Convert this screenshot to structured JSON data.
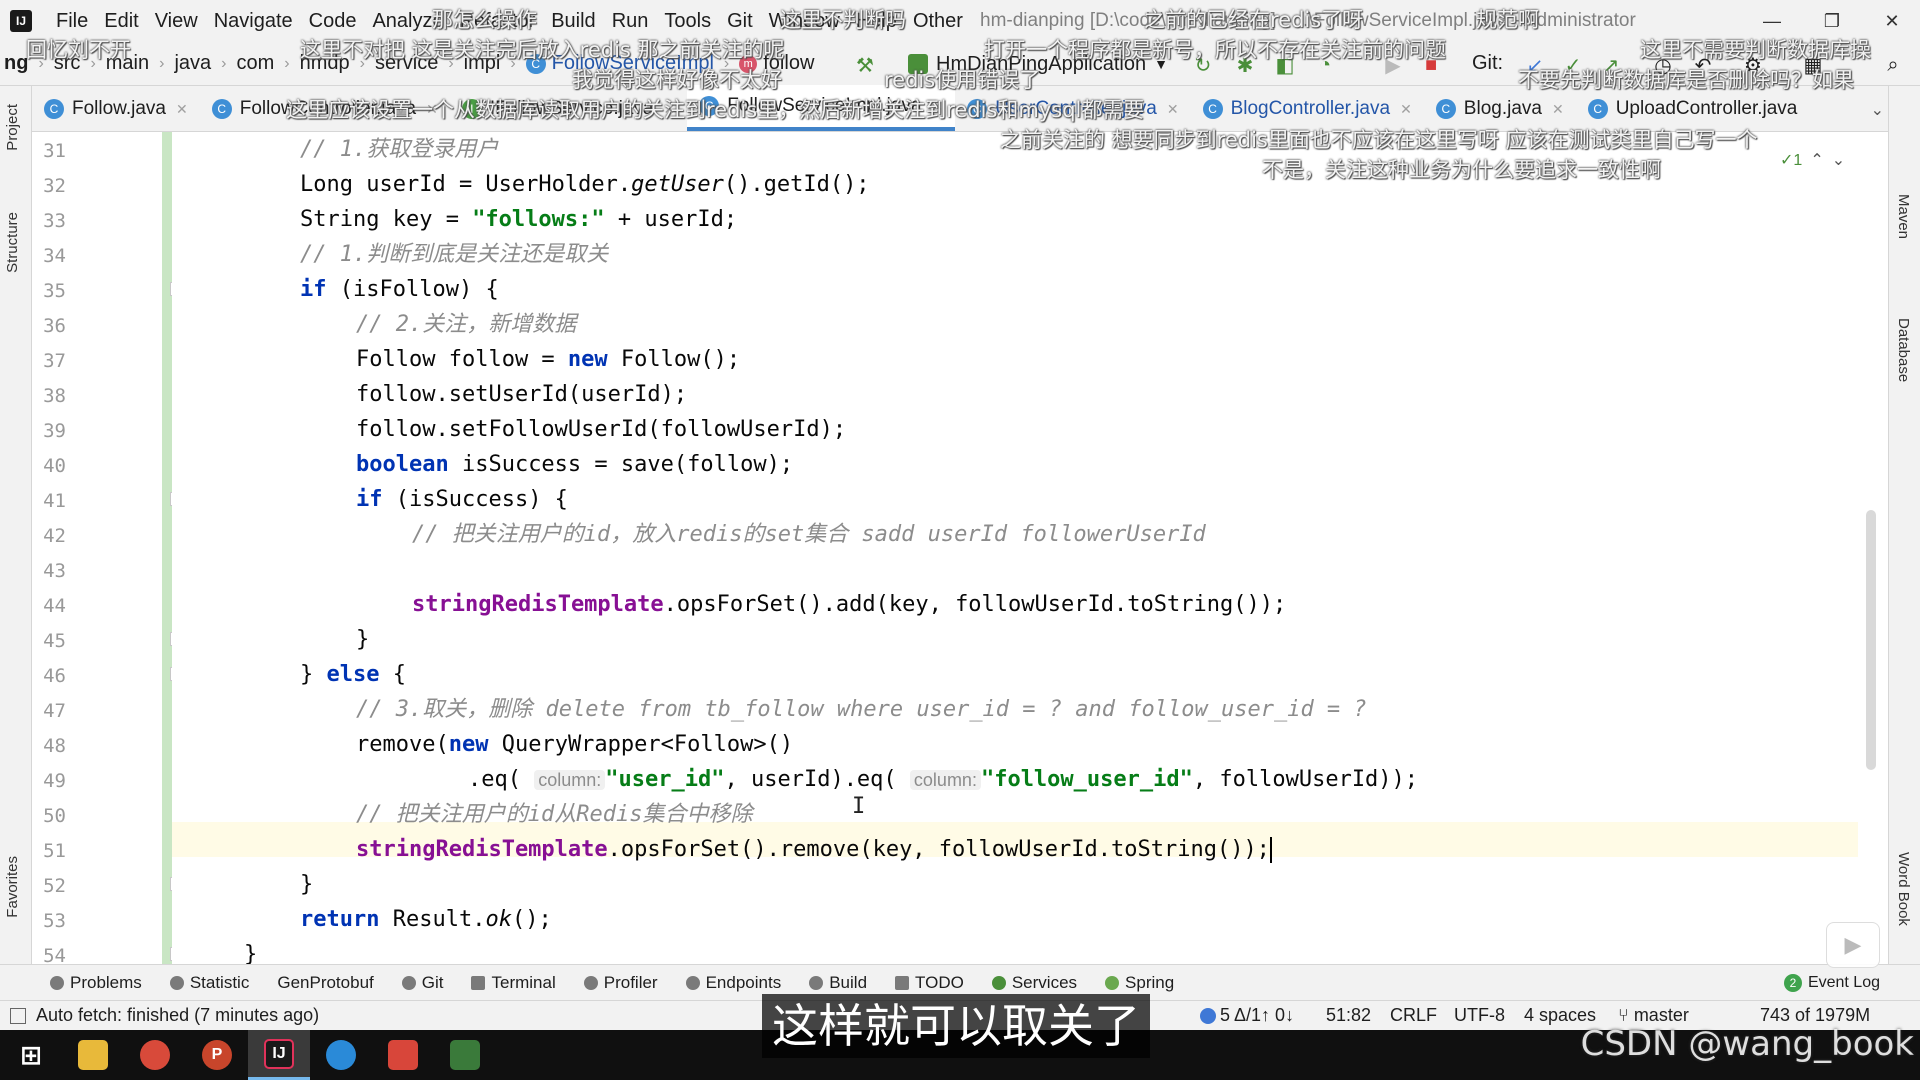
{
  "app": {
    "logo_text": "IJ",
    "window_title": "hm-dianping [D:\\code\\hm-dianping] - ...\\FollowServiceImpl.java - Administrator"
  },
  "menu": [
    "File",
    "Edit",
    "View",
    "Navigate",
    "Code",
    "Analyze",
    "Refactor",
    "Build",
    "Run",
    "Tools",
    "Git",
    "Window",
    "Help",
    "Other"
  ],
  "window_controls": {
    "minimize": "—",
    "restore": "❐",
    "close": "✕"
  },
  "breadcrumb": [
    "ng",
    "src",
    "main",
    "java",
    "com",
    "hmdp",
    "service",
    "impl",
    "FollowServiceImpl",
    "follow"
  ],
  "run_config": {
    "name": "HmDianPingApplication",
    "git_label": "Git:"
  },
  "tabs": [
    {
      "label": "Follow.java",
      "active": false
    },
    {
      "label": "FollowController.java",
      "active": false
    },
    {
      "label": "IFollowService.java",
      "active": false
    },
    {
      "label": "FollowServiceImpl.java",
      "active": true
    },
    {
      "label": "UserController.java",
      "active": false
    },
    {
      "label": "BlogController.java",
      "active": false
    },
    {
      "label": "Blog.java",
      "active": false
    },
    {
      "label": "UploadController.java",
      "active": false
    }
  ],
  "left_tool_windows": [
    "Project",
    "Structure",
    "Favorites"
  ],
  "right_tool_windows": [
    "Maven",
    "Database",
    "Word Book"
  ],
  "inspection": {
    "checks": "✓1",
    "up": "⌃",
    "down": "⌄"
  },
  "editor": {
    "line_numbers": [
      "31",
      "32",
      "33",
      "34",
      "35",
      "36",
      "37",
      "38",
      "39",
      "40",
      "41",
      "42",
      "43",
      "44",
      "45",
      "46",
      "47",
      "48",
      "49",
      "50",
      "51",
      "52",
      "53",
      "54"
    ],
    "current_line": "51",
    "hint_column": "column:",
    "lines": {
      "l31": "// 1.获取登录用户",
      "l32a": "Long userId = UserHolder.",
      "l32b": "getUser",
      "l32c": "().getId();",
      "l33a": "String key = ",
      "l33b": "\"follows:\"",
      "l33c": " + userId;",
      "l34": "// 1.判断到底是关注还是取关",
      "l35a": "if",
      "l35b": " (isFollow) {",
      "l36": "// 2.关注，新增数据",
      "l37a": "Follow follow = ",
      "l37b": "new",
      "l37c": " Follow();",
      "l38": "follow.setUserId(userId);",
      "l39": "follow.setFollowUserId(followUserId);",
      "l40a": "boolean",
      "l40b": " isSuccess = save(follow);",
      "l41a": "if",
      "l41b": " (isSuccess) {",
      "l42": "// 把关注用户的id，放入redis的set集合 sadd userId followerUserId",
      "l44a": "stringRedisTemplate",
      "l44b": ".opsForSet().add(key, followUserId.toString());",
      "l45": "}",
      "l46a": "} ",
      "l46b": "else",
      "l46c": " {",
      "l47": "// 3.取关，删除 delete from tb_follow where user_id = ? and follow_user_id = ?",
      "l48a": "remove(",
      "l48b": "new",
      "l48c": " QueryWrapper<Follow>()",
      "l49a": ".eq( ",
      "l49b": "\"user_id\"",
      "l49c": ", userId).eq( ",
      "l49d": "\"follow_user_id\"",
      "l49e": ", followUserId));",
      "l50": "// 把关注用户的id从Redis集合中移除",
      "l51a": "stringRedisTemplate",
      "l51b": ".opsForSet().remove(key, followUserId.toString());",
      "l52": "}",
      "l53a": "return",
      "l53b": " Result.",
      "l53c": "ok",
      "l53d": "();",
      "l54": "}"
    }
  },
  "tool_windows": [
    "Problems",
    "Statistic",
    "GenProtobuf",
    "Git",
    "Terminal",
    "Profiler",
    "Endpoints",
    "Build",
    "TODO",
    "Services",
    "Spring"
  ],
  "event_log": {
    "count": "2",
    "label": "Event Log"
  },
  "status": {
    "message": "Auto fetch: finished (7 minutes ago)",
    "vcs": "5 Δ/1↑ 0↓",
    "position": "51:82",
    "line_sep": "CRLF",
    "encoding": "UTF-8",
    "indent": "4 spaces",
    "branch": "master",
    "memory": "743 of 1979M"
  },
  "taskbar": [
    "Start",
    "File Explorer",
    "Chrome",
    "PowerPoint",
    "IntelliJ IDEA",
    "App",
    "App",
    "Screenshot"
  ],
  "overlay": {
    "subtitle": "这样就可以取关了",
    "watermark": "CSDN @wang_book",
    "danmaku": [
      "那怎么操作",
      "这里不判断吗",
      "之前的已经在redis了呀",
      "规范啊",
      "回忆刘不开",
      "这里不对把 这是关注完后放入redis 那之前关注的呢",
      "打开一个程序都是新号，所以不存在关注前的问题",
      "这里不需要判断数据库操",
      "我觉得这样好像不太好",
      "redis使用错误了",
      "不要先判断数据库是否删除吗？如果",
      "这里应该设置一个从数据库读取用户的关注到redis里，然后新增关注到redis和mysql都需要",
      "之前关注的 想要同步到redis里面也不应该在这里写呀 应该在测试类里自己写一个",
      "不是，关注这种业务为什么要追求一致性啊"
    ]
  }
}
